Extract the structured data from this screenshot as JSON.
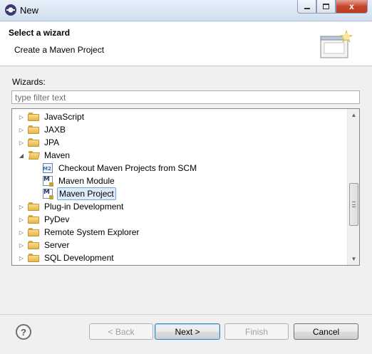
{
  "window": {
    "title": "New",
    "controls": {
      "minimize": "minimize",
      "maximize": "maximize",
      "close": "x"
    }
  },
  "banner": {
    "title": "Select a wizard",
    "description": "Create a Maven Project"
  },
  "filter": {
    "label": "Wizards:",
    "placeholder": "type filter text",
    "value": ""
  },
  "tree": {
    "nodes": [
      {
        "label": "JavaScript",
        "type": "folder",
        "expanded": false
      },
      {
        "label": "JAXB",
        "type": "folder",
        "expanded": false
      },
      {
        "label": "JPA",
        "type": "folder",
        "expanded": false
      },
      {
        "label": "Maven",
        "type": "folder",
        "expanded": true
      },
      {
        "label": "Checkout Maven Projects from SCM",
        "type": "wizard",
        "icon": "maven-checkout-icon"
      },
      {
        "label": "Maven Module",
        "type": "wizard",
        "icon": "maven-module-icon"
      },
      {
        "label": "Maven Project",
        "type": "wizard",
        "icon": "maven-project-icon",
        "selected": true
      },
      {
        "label": "Plug-in Development",
        "type": "folder",
        "expanded": false
      },
      {
        "label": "PyDev",
        "type": "folder",
        "expanded": false
      },
      {
        "label": "Remote System Explorer",
        "type": "folder",
        "expanded": false
      },
      {
        "label": "Server",
        "type": "folder",
        "expanded": false
      },
      {
        "label": "SQL Development",
        "type": "folder",
        "expanded": false
      }
    ]
  },
  "footer": {
    "help": "?",
    "back_label": "< Back",
    "next_label": "Next >",
    "finish_label": "Finish",
    "cancel_label": "Cancel"
  }
}
